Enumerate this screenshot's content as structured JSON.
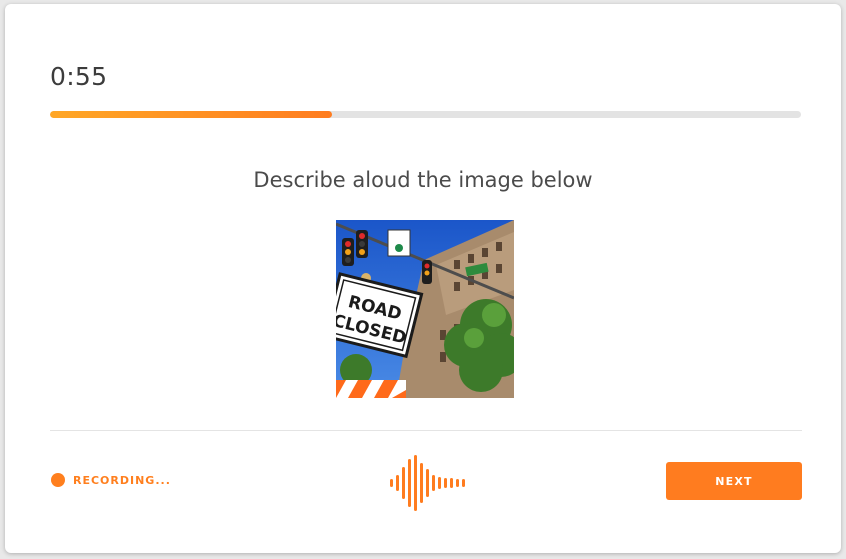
{
  "timer": {
    "text": "0:55",
    "progress_fraction": 0.375
  },
  "prompt": {
    "text": "Describe aloud the image below"
  },
  "image": {
    "sign_line1": "ROAD",
    "sign_line2": "CLOSED"
  },
  "recording": {
    "label": "RECORDING...",
    "icon": "recording-dot-icon"
  },
  "waveform": {
    "icon": "audio-waveform-icon"
  },
  "next_button": {
    "label": "NEXT"
  },
  "colors": {
    "accent": "#ff7c1f",
    "track": "#e3e3e3",
    "text": "#3c3c3c"
  }
}
